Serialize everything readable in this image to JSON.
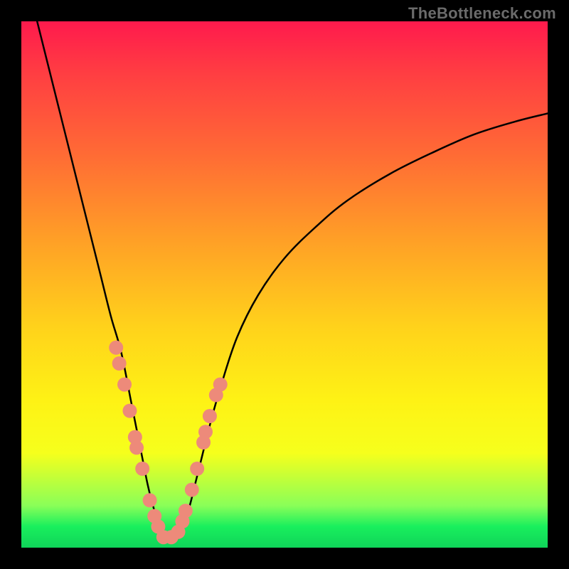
{
  "watermark": "TheBottleneck.com",
  "chart_data": {
    "type": "line",
    "title": "",
    "xlabel": "",
    "ylabel": "",
    "xlim": [
      0,
      100
    ],
    "ylim": [
      0,
      100
    ],
    "axes_visible": false,
    "grid": false,
    "background": "black-border-with-vertical-rainbow-gradient",
    "gradient_stops": [
      {
        "pos": 0.0,
        "color": "#ff1a4d"
      },
      {
        "pos": 0.1,
        "color": "#ff3e42"
      },
      {
        "pos": 0.25,
        "color": "#ff6a35"
      },
      {
        "pos": 0.42,
        "color": "#ffa126"
      },
      {
        "pos": 0.58,
        "color": "#ffd21b"
      },
      {
        "pos": 0.72,
        "color": "#fef215"
      },
      {
        "pos": 0.82,
        "color": "#f6ff1c"
      },
      {
        "pos": 0.92,
        "color": "#8aff58"
      },
      {
        "pos": 0.96,
        "color": "#19ef5d"
      },
      {
        "pos": 1.0,
        "color": "#0fd459"
      }
    ],
    "series": [
      {
        "name": "bottleneck-curve",
        "color": "#000000",
        "stroke_width": 2.5,
        "x": [
          3,
          5,
          7,
          9,
          11,
          13,
          15,
          17,
          19,
          21,
          23,
          24,
          25,
          26,
          27,
          28,
          29,
          30,
          31,
          32,
          33,
          34,
          36,
          38,
          41,
          45,
          50,
          56,
          62,
          70,
          78,
          86,
          94,
          100
        ],
        "y": [
          100,
          92,
          84,
          76,
          68,
          60,
          52,
          44,
          37,
          27,
          17,
          12,
          8,
          5,
          3,
          2,
          2,
          3,
          5,
          8,
          12,
          16,
          24,
          31,
          40,
          48,
          55,
          61,
          66,
          71,
          75,
          78.5,
          81,
          82.5
        ]
      }
    ],
    "markers": [
      {
        "name": "data-scatter",
        "shape": "circle",
        "color": "#ed8a7a",
        "radius": 10,
        "points": [
          {
            "x": 18.0,
            "y": 38
          },
          {
            "x": 18.6,
            "y": 35
          },
          {
            "x": 19.6,
            "y": 31
          },
          {
            "x": 20.6,
            "y": 26
          },
          {
            "x": 21.6,
            "y": 21
          },
          {
            "x": 21.9,
            "y": 19
          },
          {
            "x": 23.0,
            "y": 15
          },
          {
            "x": 24.4,
            "y": 9
          },
          {
            "x": 25.3,
            "y": 6
          },
          {
            "x": 26.0,
            "y": 4
          },
          {
            "x": 27.0,
            "y": 2
          },
          {
            "x": 28.5,
            "y": 2
          },
          {
            "x": 29.8,
            "y": 3
          },
          {
            "x": 30.6,
            "y": 5
          },
          {
            "x": 31.2,
            "y": 7
          },
          {
            "x": 32.4,
            "y": 11
          },
          {
            "x": 33.4,
            "y": 15
          },
          {
            "x": 34.6,
            "y": 20
          },
          {
            "x": 35.0,
            "y": 22
          },
          {
            "x": 35.8,
            "y": 25
          },
          {
            "x": 37.0,
            "y": 29
          },
          {
            "x": 37.8,
            "y": 31
          }
        ]
      }
    ]
  }
}
